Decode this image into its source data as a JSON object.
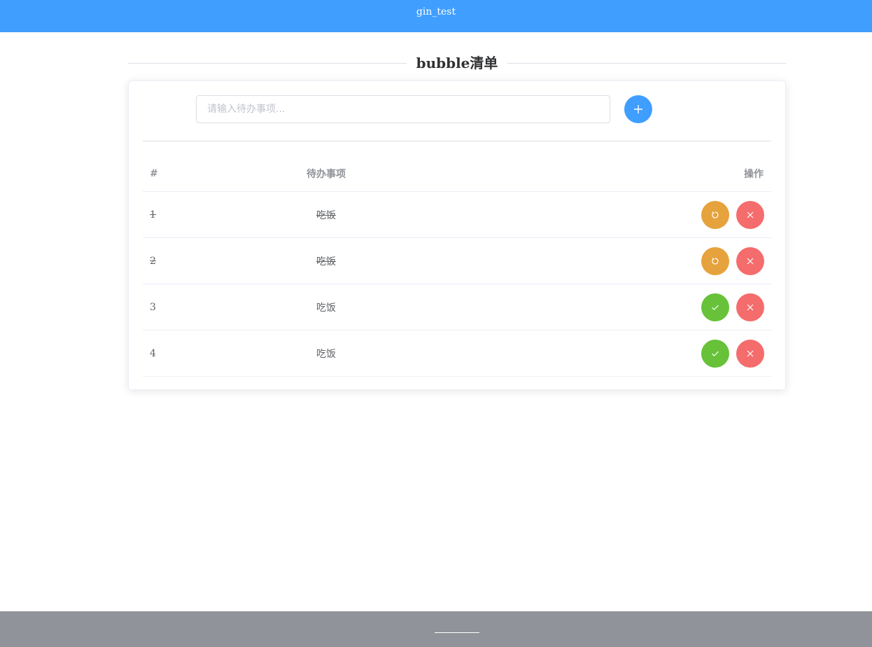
{
  "header": {
    "title": "gin_test",
    "color": "#409eff"
  },
  "page_title": "bubble清单",
  "input": {
    "placeholder": "请输入待办事项...",
    "value": ""
  },
  "add_button": {
    "icon": "plus-icon"
  },
  "table": {
    "headers": {
      "index": "#",
      "item": "待办事项",
      "ops": "操作"
    },
    "rows": [
      {
        "index": "1",
        "item": "吃饭",
        "done": true,
        "toggle_icon": "refresh-icon",
        "delete_icon": "close-icon"
      },
      {
        "index": "2",
        "item": "吃饭",
        "done": true,
        "toggle_icon": "refresh-icon",
        "delete_icon": "close-icon"
      },
      {
        "index": "3",
        "item": "吃饭",
        "done": false,
        "toggle_icon": "check-icon",
        "delete_icon": "close-icon"
      },
      {
        "index": "4",
        "item": "吃饭",
        "done": false,
        "toggle_icon": "check-icon",
        "delete_icon": "close-icon"
      }
    ]
  },
  "colors": {
    "primary": "#409eff",
    "warning": "#e6a23c",
    "danger": "#f56c6c",
    "success": "#67c23a",
    "footer": "#909399"
  }
}
